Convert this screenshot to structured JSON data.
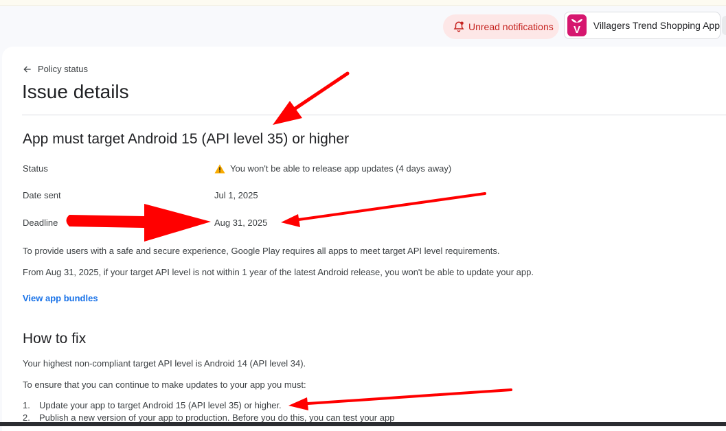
{
  "header": {
    "notifications_label": "Unread notifications",
    "app_name": "Villagers Trend Shopping App",
    "app_icon_letter": "V",
    "app_icon_color": "#d6176f"
  },
  "breadcrumb": {
    "back_label": "Policy status"
  },
  "page": {
    "title": "Issue details"
  },
  "issue": {
    "title": "App must target Android 15 (API level 35) or higher",
    "status_label": "Status",
    "status_value": "You won't be able to release app updates (4 days away)",
    "date_sent_label": "Date sent",
    "date_sent_value": "Jul 1, 2025",
    "deadline_label": "Deadline",
    "deadline_value": "Aug 31, 2025",
    "para1": "To provide users with a safe and secure experience, Google Play requires all apps to meet target API level requirements.",
    "para2": "From Aug 31, 2025, if your target API level is not within 1 year of the latest Android release, you won't be able to update your app.",
    "link_label": "View app bundles"
  },
  "how_to_fix": {
    "title": "How to fix",
    "para1": "Your highest non-compliant target API level is Android 14 (API level 34).",
    "para2": "To ensure that you can continue to make updates to your app you must:",
    "steps": [
      {
        "num": "1.",
        "text": "Update your app to target Android 15 (API level 35) or higher."
      },
      {
        "num": "2.",
        "text": "Publish a new version of your app to production. Before you do this, you can test your app"
      }
    ]
  },
  "colors": {
    "accent_link": "#1a73e8",
    "notification_bg": "#fde7e7",
    "notification_text": "#c5221f",
    "warning": "#f9ab00",
    "annotation_arrow": "#ff0000"
  }
}
